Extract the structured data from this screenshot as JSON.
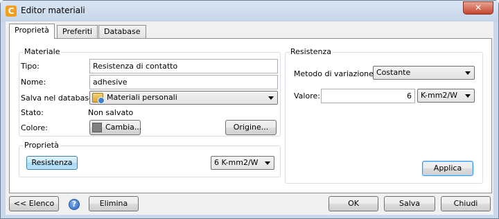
{
  "window": {
    "title": "Editor materiali",
    "close_glyph": "✕",
    "app_icon_glyph": "C"
  },
  "tabs": [
    {
      "label": "Proprietà"
    },
    {
      "label": "Preferiti"
    },
    {
      "label": "Database"
    }
  ],
  "materiale": {
    "group_label": "Materiale",
    "tipo_label": "Tipo:",
    "tipo_value": "Resistenza di contatto",
    "nome_label": "Nome:",
    "nome_value": "adhesive",
    "salva_label": "Salva nel database:",
    "salva_value": "Materiali personali",
    "stato_label": "Stato:",
    "stato_value": "Non salvato",
    "colore_label": "Colore:",
    "colore_button": "Cambia...",
    "origine_button": "Origine..."
  },
  "proprieta": {
    "group_label": "Proprietà",
    "resistenza_button": "Resistenza",
    "value_combo": "6 K-mm2/W"
  },
  "resistenza": {
    "group_label": "Resistenza",
    "metodo_label": "Metodo di variazione:",
    "metodo_value": "Costante",
    "valore_label": "Valore:",
    "valore_value": "6",
    "unit_value": "K-mm2/W",
    "applica_button": "Applica"
  },
  "footer": {
    "elenco_button": "<< Elenco",
    "help_glyph": "?",
    "elimina_button": "Elimina",
    "ok_button": "OK",
    "salva_button": "Salva",
    "chiudi_button": "Chiudi"
  },
  "colors": {
    "swatch": "#808080",
    "accent": "#3399ff"
  }
}
